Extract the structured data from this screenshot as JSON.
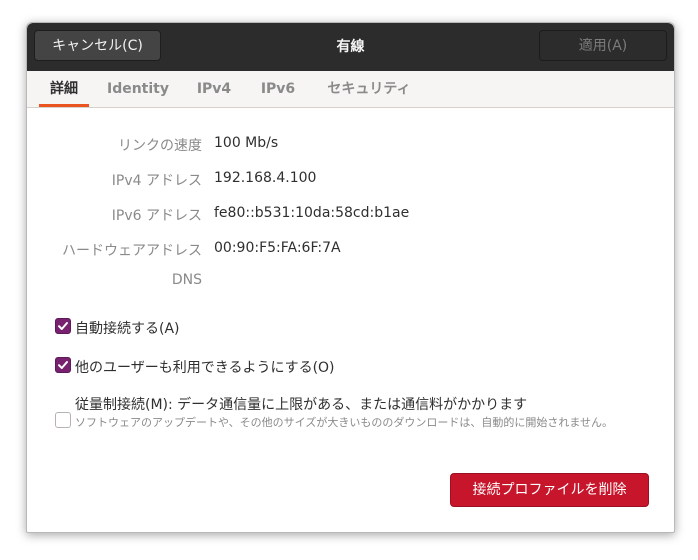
{
  "header": {
    "title": "有線",
    "cancel_label": "キャンセル(C)",
    "apply_label": "適用(A)"
  },
  "tabs": [
    {
      "label": "詳細",
      "active": true
    },
    {
      "label": "Identity",
      "active": false
    },
    {
      "label": "IPv4",
      "active": false
    },
    {
      "label": "IPv6",
      "active": false
    },
    {
      "label": "セキュリティ",
      "active": false
    }
  ],
  "details": [
    {
      "label": "リンクの速度",
      "value": "100 Mb/s"
    },
    {
      "label": "IPv4 アドレス",
      "value": "192.168.4.100"
    },
    {
      "label": "IPv6 アドレス",
      "value": "fe80::b531:10da:58cd:b1ae"
    },
    {
      "label": "ハードウェアアドレス",
      "value": "00:90:F5:FA:6F:7A"
    },
    {
      "label": "DNS",
      "value": ""
    }
  ],
  "options": {
    "auto_connect": {
      "label": "自動接続する(A)",
      "checked": true
    },
    "all_users": {
      "label": "他のユーザーも利用できるようにする(O)",
      "checked": true
    },
    "metered": {
      "label": "従量制接続(M): データ通信量に上限がある、または通信料がかかります",
      "description": "ソフトウェアのアップデートや、その他のサイズが大きいもののダウンロードは、自動的に開始されません。",
      "checked": false
    }
  },
  "actions": {
    "delete_label": "接続プロファイルを削除"
  },
  "colors": {
    "header_bg": "#2c2c2c",
    "accent_tab": "#e95420",
    "checkbox": "#77216f",
    "destructive": "#c7162b"
  }
}
